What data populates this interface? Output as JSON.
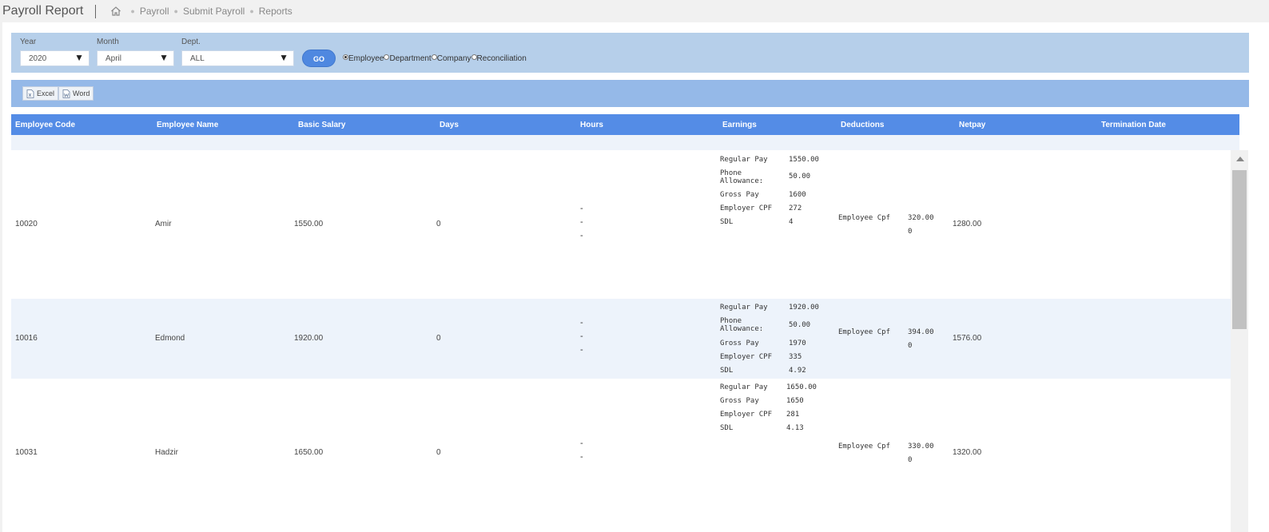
{
  "header": {
    "title": "Payroll Report",
    "breadcrumbs": [
      "Payroll",
      "Submit Payroll",
      "Reports"
    ]
  },
  "filters": {
    "year_label": "Year",
    "year_value": "2020",
    "month_label": "Month",
    "month_value": "April",
    "dept_label": "Dept.",
    "dept_value": "ALL",
    "go_label": "GO",
    "radio_options": [
      "Employee",
      "Department",
      "Company",
      "Reconciliation"
    ],
    "selected_radio": "Employee"
  },
  "export": {
    "excel_label": "Excel",
    "word_label": "Word"
  },
  "table": {
    "columns": [
      "Employee Code",
      "Employee Name",
      "Basic Salary",
      "Days",
      "Hours",
      "Earnings",
      "Deductions",
      "Netpay",
      "Termination Date"
    ],
    "rows": [
      {
        "code": "10020",
        "name": "Amir",
        "basic": "1550.00",
        "days": "0",
        "hours": [
          "-",
          "-",
          "-"
        ],
        "earnings": [
          {
            "label": "Regular Pay",
            "value": "1550.00"
          },
          {
            "label": "Phone Allowance:",
            "value": "50.00"
          },
          {
            "label": "Gross Pay",
            "value": "1600"
          },
          {
            "label": "Employer CPF",
            "value": "272"
          },
          {
            "label": "SDL",
            "value": "4"
          }
        ],
        "deduction_label": "Employee Cpf",
        "deduction_value": "320.00",
        "deduction_value2": "0",
        "netpay": "1280.00",
        "termination": ""
      },
      {
        "code": "10016",
        "name": "Edmond",
        "basic": "1920.00",
        "days": "0",
        "hours": [
          "-",
          "-",
          "-"
        ],
        "earnings": [
          {
            "label": "Regular Pay",
            "value": "1920.00"
          },
          {
            "label": "Phone Allowance:",
            "value": "50.00"
          },
          {
            "label": "Gross Pay",
            "value": "1970"
          },
          {
            "label": "Employer CPF",
            "value": "335"
          },
          {
            "label": "SDL",
            "value": "4.92"
          }
        ],
        "deduction_label": "Employee Cpf",
        "deduction_value": "394.00",
        "deduction_value2": "0",
        "netpay": "1576.00",
        "termination": ""
      },
      {
        "code": "10031",
        "name": "Hadzir",
        "basic": "1650.00",
        "days": "0",
        "hours": [
          "-",
          "-"
        ],
        "earnings": [
          {
            "label": "Regular Pay",
            "value": "1650.00"
          },
          {
            "label": "Gross Pay",
            "value": "1650"
          },
          {
            "label": "Employer CPF",
            "value": "281"
          },
          {
            "label": "SDL",
            "value": "4.13"
          }
        ],
        "deduction_label": "Employee Cpf",
        "deduction_value": "330.00",
        "deduction_value2": "0",
        "netpay": "1320.00",
        "termination": ""
      }
    ]
  }
}
